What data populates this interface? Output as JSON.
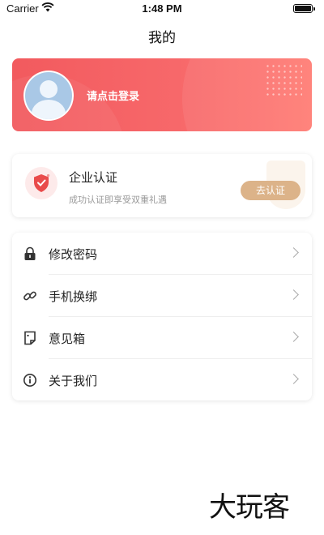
{
  "status_bar": {
    "carrier": "Carrier",
    "time": "1:48 PM"
  },
  "nav": {
    "title": "我的"
  },
  "login": {
    "prompt": "请点击登录"
  },
  "certification": {
    "title": "企业认证",
    "subtitle": "成功认证即享受双重礼遇",
    "button_label": "去认证"
  },
  "menu": {
    "items": [
      {
        "label": "修改密码",
        "icon": "lock-icon"
      },
      {
        "label": "手机换绑",
        "icon": "link-icon"
      },
      {
        "label": "意见箱",
        "icon": "feedback-icon"
      },
      {
        "label": "关于我们",
        "icon": "info-icon"
      }
    ]
  },
  "watermark": {
    "text": "大玩客"
  },
  "colors": {
    "login_card": "#f7686a",
    "cert_button": "#dcb389",
    "cert_icon": "#e94b4b"
  }
}
